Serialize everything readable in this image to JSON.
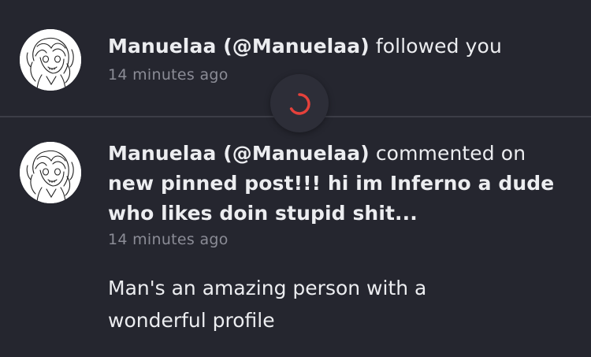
{
  "notifications": [
    {
      "user_display": "Manuelaa (@Manuelaa)",
      "action": " followed you",
      "time": "14 minutes ago",
      "avatar": "avatar-sketch-icon"
    },
    {
      "user_display": "Manuelaa (@Manuelaa)",
      "action": " commented on ",
      "post_title": "new pinned post!!! hi im Inferno a dude who likes doin stupid shit...",
      "time": "14 minutes ago",
      "comment": "Man's an amazing person with a wonderful profile",
      "avatar": "avatar-sketch-icon"
    }
  ],
  "loading": {
    "icon": "loading-spinner-icon",
    "color": "#e5413b"
  },
  "colors": {
    "background": "#25262f",
    "text_primary": "#ecedf0",
    "text_secondary": "#8b8c96",
    "divider": "#3c3d47"
  }
}
